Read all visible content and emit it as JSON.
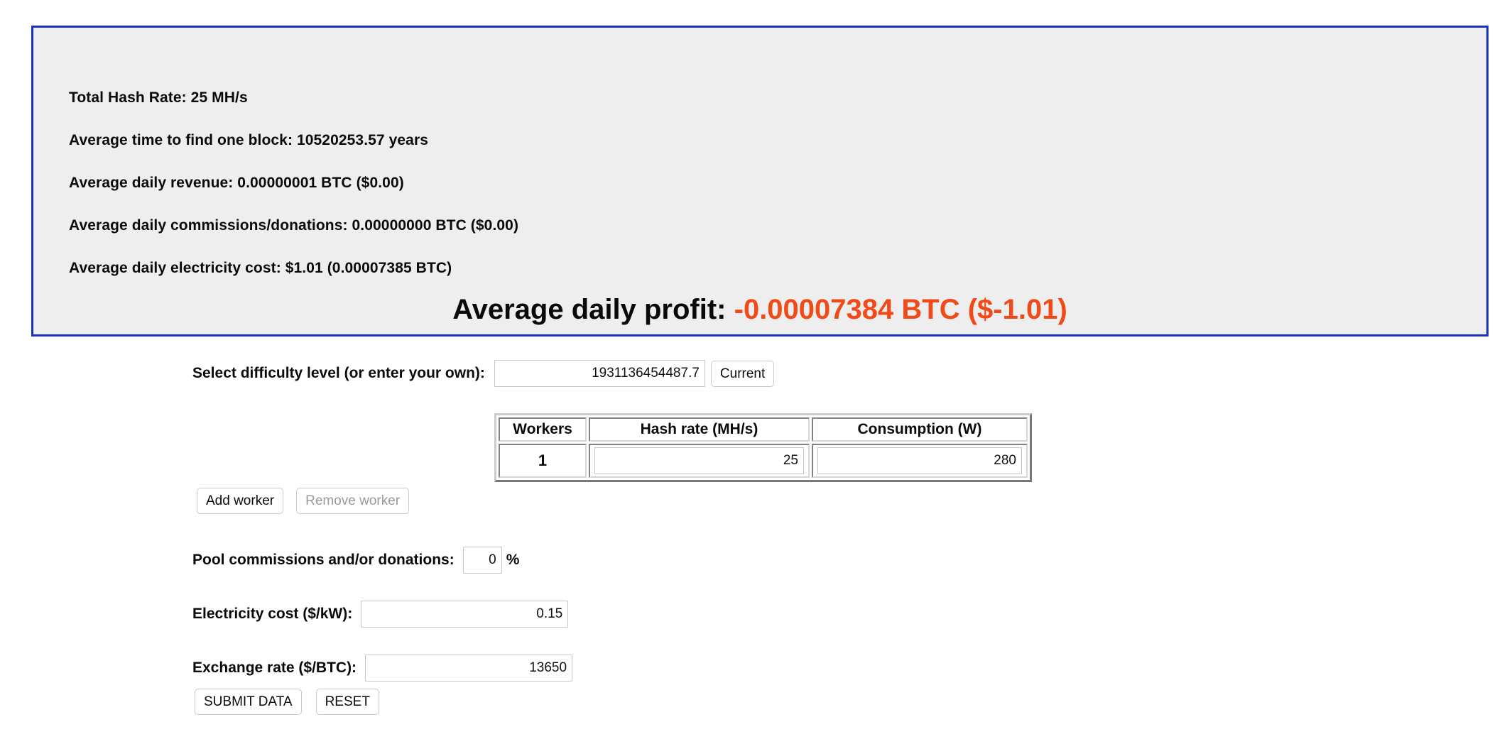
{
  "results": {
    "lines": [
      "Total Hash Rate: 25 MH/s",
      "Average time to find one block: 10520253.57 years",
      "Average daily revenue: 0.00000001 BTC ($0.00)",
      "Average daily commissions/donations: 0.00000000 BTC ($0.00)",
      "Average daily electricity cost: $1.01 (0.00007385 BTC)"
    ],
    "profit_label": "Average daily profit:",
    "profit_value": "-0.00007384 BTC ($-1.01)",
    "profit_color": "#f04a18",
    "panel_border_color": "#1a33bd",
    "panel_background": "#eeeeee"
  },
  "form": {
    "difficulty": {
      "label": "Select difficulty level (or enter your own):",
      "value": "1931136454487.7",
      "placeholder": "",
      "current_button": "Current"
    },
    "workers_table": {
      "headers": [
        "Workers",
        "Hash rate (MH/s)",
        "Consumption (W)"
      ],
      "rows": [
        {
          "index": "1",
          "hash_rate": "25",
          "consumption": "280"
        }
      ]
    },
    "worker_buttons": {
      "add": "Add worker",
      "remove": "Remove worker"
    },
    "commissions": {
      "label": "Pool commissions and/or donations:",
      "value": "0",
      "unit": "%"
    },
    "electricity": {
      "label": "Electricity cost ($/kW):",
      "value": "0.15"
    },
    "exchange": {
      "label": "Exchange rate ($/BTC):",
      "value": "13650"
    },
    "actions": {
      "submit": "SUBMIT DATA",
      "reset": "RESET"
    }
  }
}
